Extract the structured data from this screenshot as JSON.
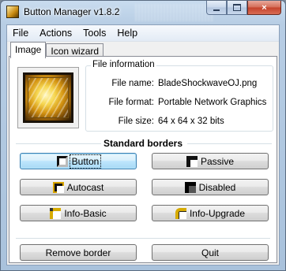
{
  "window": {
    "title": "Button Manager v1.8.2",
    "icon": "app-icon",
    "caption_buttons": [
      "minimize",
      "maximize",
      "close"
    ],
    "close_glyph": "×"
  },
  "menu": {
    "items": [
      {
        "label": "File"
      },
      {
        "label": "Actions"
      },
      {
        "label": "Tools"
      },
      {
        "label": "Help"
      }
    ]
  },
  "tabs": [
    {
      "label": "Image",
      "active": true
    },
    {
      "label": "Icon wizard",
      "active": false
    }
  ],
  "file_info": {
    "legend": "File information",
    "rows": [
      {
        "label": "File name:",
        "value": "BladeShockwaveOJ.png"
      },
      {
        "label": "File format:",
        "value": "Portable Network Graphics"
      },
      {
        "label": "File size:",
        "value": "64 x 64 x 32 bits"
      }
    ]
  },
  "preview": {
    "icon": "blade-shockwave-image"
  },
  "standard_borders": {
    "title": "Standard borders",
    "buttons": [
      {
        "label": "Button",
        "icon": "button-border-icon"
      },
      {
        "label": "Passive",
        "icon": "passive-border-icon"
      },
      {
        "label": "Autocast",
        "icon": "autocast-border-icon"
      },
      {
        "label": "Disabled",
        "icon": "disabled-border-icon"
      },
      {
        "label": "Info-Basic",
        "icon": "info-basic-border-icon"
      },
      {
        "label": "Info-Upgrade",
        "icon": "info-upgrade-border-icon"
      }
    ]
  },
  "actions": {
    "remove_border": "Remove border",
    "quit": "Quit"
  },
  "colors": {
    "focus_border": "#3c7fb1",
    "gold_accent": "#d7ab00",
    "window_frame": "#b7cde4",
    "close_button": "#c4412a"
  }
}
